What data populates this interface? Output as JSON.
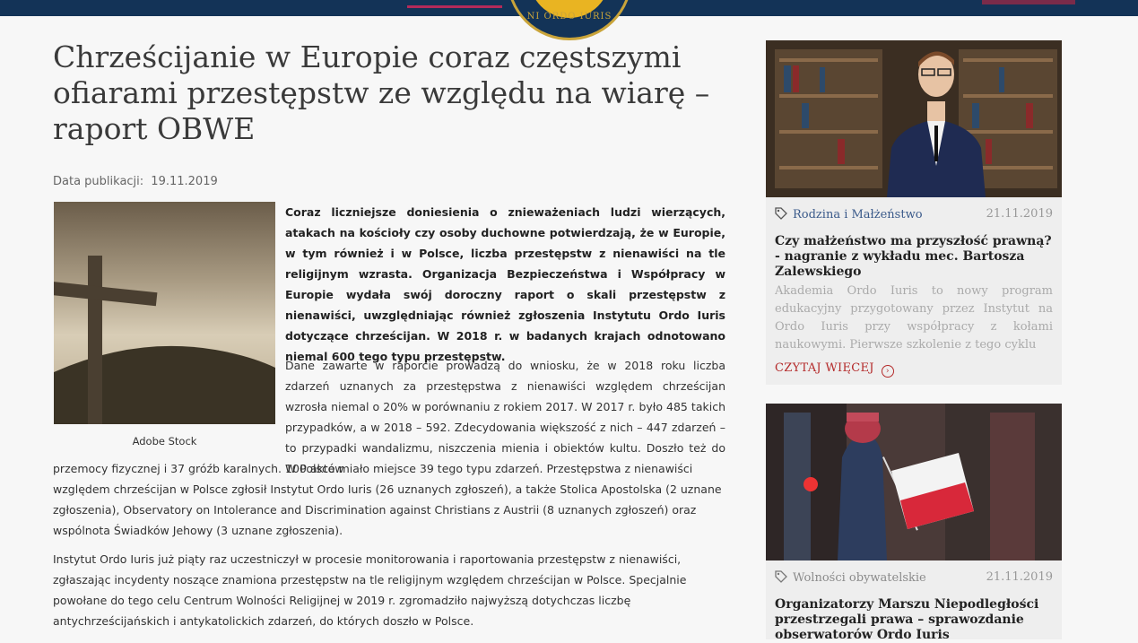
{
  "header": {
    "logo_text": "NI ORDO IURIS"
  },
  "article": {
    "title": "Chrześcijanie w Europie coraz częstszymi ofiarami przestępstw ze względu na wiarę – raport OBWE",
    "pub_label": "Data publikacji:",
    "pub_date": "19.11.2019",
    "image_caption": "Adobe Stock",
    "lead": "Coraz liczniejsze doniesienia o znieważeniach ludzi wierzących, atakach na kościoły czy osoby duchowne potwierdzają, że w Europie, w tym również i w Polsce, liczba przestępstw z nienawiści na tle religijnym wzrasta. Organizacja Bezpieczeństwa i Współpracy w Europie wydała swój doroczny raport o skali przestępstw z nienawiści, uwzględniając również zgłoszenia Instytutu Ordo Iuris dotyczące chrześcijan. W 2018 r. w badanych krajach odnotowano niemal 600 tego typu przestępstw.",
    "p1_part1": "Dane zawarte w raporcie prowadzą do wniosku, że w 2018 roku liczba zdarzeń uznanych za przestępstwa z nienawiści względem chrześcijan wzrosła niemal o 20% w porównaniu z rokiem 2017. W 2017 r. było 485 takich przypadków, a w 2018 – 592. Zdecydowania większość z nich – 447 zdarzeń – to przypadki wandalizmu, niszczenia mienia i obiektów kultu. Doszło też do 100 aktów",
    "p1_part2": "przemocy fizycznej i 37 gróźb karalnych. W Polsce miało miejsce 39 tego typu zdarzeń. Przestępstwa z nienawiści względem chrześcijan w Polsce zgłosił Instytut Ordo Iuris (26 uznanych zgłoszeń), a także Stolica Apostolska (2 uznane zgłoszenia), Observatory on Intolerance and Discrimination against Christians z Austrii (8 uznanych zgłoszeń) oraz wspólnota Świadków Jehowy (3 uznane zgłoszenia).",
    "p2": "Instytut Ordo Iuris już piąty raz uczestniczył w procesie monitorowania i raportowania przestępstw z nienawiści, zgłaszając incydenty noszące znamiona przestępstw na tle religijnym względem chrześcijan w Polsce. Specjalnie powołane do tego celu Centrum Wolności Religijnej w 2019 r. zgromadziło najwyższą dotychczas liczbę antychrześcijańskich i antykatolickich zdarzeń, do których doszło w Polsce."
  },
  "sidebar": {
    "cards": [
      {
        "category": "Rodzina i Małżeństwo",
        "date": "21.11.2019",
        "title": "Czy małżeństwo ma przyszłość prawną? - nagranie z wykładu mec. Bartosza Zalewskiego",
        "excerpt": "Akademia Ordo Iuris to nowy program edukacyjny przygotowany przez Instytut na Ordo Iuris przy współpracy z kołami naukowymi. Pierwsze szkolenie z tego cyklu",
        "more": "CZYTAJ WIĘCEJ"
      },
      {
        "category": "Wolności obywatelskie",
        "date": "21.11.2019",
        "title": "Organizatorzy Marszu Niepodległości przestrzegali prawa – sprawozdanie obserwatorów Ordo Iuris"
      }
    ]
  },
  "colors": {
    "navy": "#133357",
    "accent": "#b42a2a",
    "category_blue": "#3a5a8a"
  }
}
